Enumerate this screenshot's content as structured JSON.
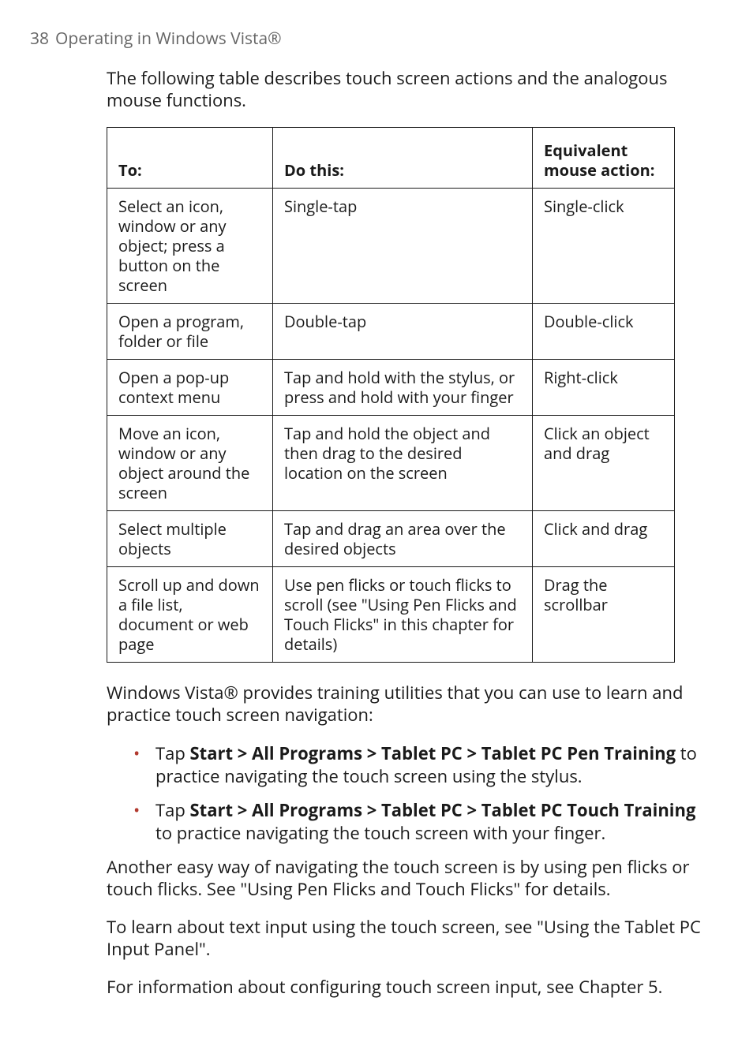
{
  "header": {
    "page_number": "38",
    "chapter_title": "Operating in Windows Vista®"
  },
  "intro_para": "The following table describes touch screen actions and the analogous mouse functions.",
  "table": {
    "headers": {
      "c0": "To:",
      "c1": "Do this:",
      "c2": "Equivalent mouse action:"
    },
    "rows": [
      {
        "to": "Select an icon, window or any object; press a button on the screen",
        "do": "Single-tap",
        "mouse": "Single-click"
      },
      {
        "to": "Open a program, folder or file",
        "do": "Double-tap",
        "mouse": "Double-click"
      },
      {
        "to": "Open a pop-up context menu",
        "do": "Tap and hold with the stylus, or press and hold with your finger",
        "mouse": "Right-click"
      },
      {
        "to": "Move an icon, window or any object around the screen",
        "do": "Tap and hold the object and then drag to the desired location on the screen",
        "mouse": "Click an object and drag"
      },
      {
        "to": "Select multiple objects",
        "do": "Tap and drag an area over the desired objects",
        "mouse": "Click and drag"
      },
      {
        "to": "Scroll up and down a file list, document or web page",
        "do": "Use pen flicks or touch flicks to scroll (see \"Using Pen Flicks and Touch Flicks\" in this chapter for details)",
        "mouse": "Drag the scrollbar"
      }
    ]
  },
  "training_para": "Windows Vista® provides training utilities that you can use to learn and practice touch screen navigation:",
  "bullets": [
    {
      "pre": "Tap ",
      "bold": "Start > All Programs > Tablet PC > Tablet PC Pen Training",
      "post": " to practice navigating the touch screen using the stylus."
    },
    {
      "pre": "Tap ",
      "bold": "Start > All Programs > Tablet PC > Tablet PC Touch Training",
      "post": " to practice navigating the touch screen with your finger."
    }
  ],
  "para_flicks": "Another easy way of navigating the touch screen is by using pen flicks or touch flicks. See \"Using Pen Flicks and Touch Flicks\" for details.",
  "para_input_panel": "To learn about text input using the touch screen, see \"Using the Tablet PC Input Panel\".",
  "para_chapter5": "For information about configuring touch screen input, see Chapter 5."
}
